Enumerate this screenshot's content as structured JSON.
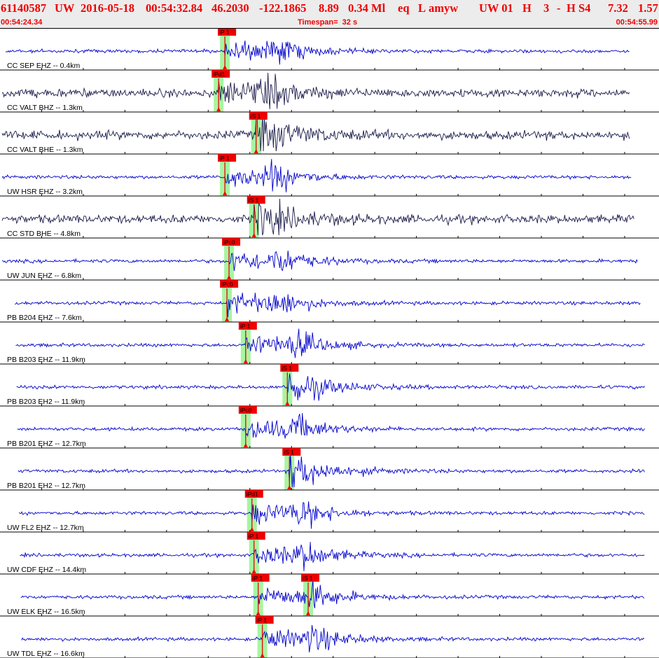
{
  "header": {
    "title_parts": [
      "61140587",
      "UW",
      "2016-05-18",
      "00:54:32.84",
      "46.2030",
      "-122.1865",
      "8.89",
      "0.34 Ml",
      "eq",
      "L",
      "amyw",
      "UW 01",
      "H",
      "3",
      "-",
      "H S4",
      "7.32",
      "1.57"
    ],
    "start_time": "00:54:24.34",
    "timespan_label": "Timespan=  32 s",
    "end_time": "00:54:55.99"
  },
  "colors": {
    "header_text": "#ee0000",
    "header_bg": "#ececec",
    "trace_z": "#0000cc",
    "trace_h": "#1a1a4a",
    "pick_bg": "#ee0000",
    "pick_band": "#a8f5a0",
    "divider": "#000000"
  },
  "chart_data": {
    "type": "seismogram",
    "x_range_s": [
      0,
      31.65
    ],
    "traces": [
      {
        "label": "CC SEP EHZ -- 0.4km",
        "p": {
          "label": "iP 1",
          "t": 10.8
        },
        "s": null,
        "color": "z",
        "signal_end_s": 31.6
      },
      {
        "label": "CC VALT BHZ -- 1.3km",
        "p": {
          "label": "iPd1",
          "t": 10.5
        },
        "s": null,
        "color": "h",
        "signal_end_s": 31.6
      },
      {
        "label": "CC VALT BHE -- 1.3km",
        "p": null,
        "s": {
          "label": "iS 1",
          "t": 12.3
        },
        "color": "h",
        "signal_end_s": 31.6
      },
      {
        "label": "UW HSR EHZ -- 3.2km",
        "p": {
          "label": "iP 1",
          "t": 10.8
        },
        "s": null,
        "color": "z",
        "signal_end_s": 31.7
      },
      {
        "label": "CC STD BHE -- 4.8km",
        "p": null,
        "s": {
          "label": "iS 1",
          "t": 12.2
        },
        "color": "h",
        "signal_end_s": 31.8
      },
      {
        "label": "UW JUN EHZ -- 6.8km",
        "p": {
          "label": "iPc0",
          "t": 11.0
        },
        "s": null,
        "color": "z",
        "signal_end_s": 32.0
      },
      {
        "label": "PB B204 EHZ -- 7.6km",
        "p": {
          "label": "iPc0",
          "t": 10.9
        },
        "s": null,
        "color": "z",
        "signal_end_s": 32.1
      },
      {
        "label": "PB B203 EHZ -- 11.9km",
        "p": {
          "label": "iP 1",
          "t": 11.8
        },
        "s": null,
        "color": "z",
        "signal_end_s": 32.6
      },
      {
        "label": "PB B203 EH2 -- 11.9km",
        "p": null,
        "s": {
          "label": "iS 1",
          "t": 13.8
        },
        "color": "z",
        "signal_end_s": 32.6
      },
      {
        "label": "PB B201 EHZ -- 12.7km",
        "p": {
          "label": "iPc0",
          "t": 11.8
        },
        "s": null,
        "color": "z",
        "signal_end_s": 32.7
      },
      {
        "label": "PB B201 EH2 -- 12.7km",
        "p": null,
        "s": {
          "label": "iS 1",
          "t": 13.9
        },
        "color": "z",
        "signal_end_s": 32.7
      },
      {
        "label": "UW FL2 EHZ -- 12.7km",
        "p": {
          "label": "iPd1",
          "t": 12.1
        },
        "s": null,
        "color": "z",
        "signal_end_s": 32.7
      },
      {
        "label": "UW CDF EHZ -- 14.4km",
        "p": {
          "label": "iP 1",
          "t": 12.2
        },
        "s": null,
        "color": "z",
        "signal_end_s": 32.7
      },
      {
        "label": "UW ELK EHZ -- 16.5km",
        "p": {
          "label": "iP 1",
          "t": 12.4
        },
        "s": {
          "label": "iS 1",
          "t": 14.8
        },
        "color": "z",
        "signal_end_s": 32.7
      },
      {
        "label": "UW TDL EHZ -- 16.6km",
        "p": {
          "label": "iP 1",
          "t": 12.6
        },
        "s": null,
        "color": "z",
        "signal_end_s": 32.7
      }
    ]
  }
}
